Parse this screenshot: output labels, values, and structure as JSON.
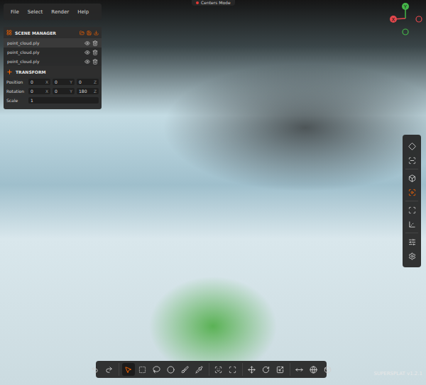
{
  "menu": {
    "items": [
      "File",
      "Select",
      "Render",
      "Help"
    ]
  },
  "mode_badge": {
    "label": "Centers Mode",
    "color": "#e53935"
  },
  "gizmo": {
    "axes": [
      {
        "label": "Y",
        "color": "#45b649"
      },
      {
        "label": "X",
        "color": "#e5484d"
      }
    ]
  },
  "scene_manager": {
    "title": "SCENE MANAGER",
    "items": [
      {
        "name": "point_cloud.ply",
        "visible": true,
        "selected": true
      },
      {
        "name": "point_cloud.ply",
        "visible": true,
        "selected": false
      },
      {
        "name": "point_cloud.ply",
        "visible": true,
        "selected": false
      }
    ]
  },
  "transform": {
    "title": "TRANSFORM",
    "rows": [
      {
        "label": "Position",
        "fields": [
          {
            "value": "0",
            "axis": "X"
          },
          {
            "value": "0",
            "axis": "Y"
          },
          {
            "value": "0",
            "axis": "Z"
          }
        ]
      },
      {
        "label": "Rotation",
        "fields": [
          {
            "value": "0",
            "axis": "X"
          },
          {
            "value": "0",
            "axis": "Y"
          },
          {
            "value": "180",
            "axis": "Z"
          }
        ]
      },
      {
        "label": "Scale",
        "fields": [
          {
            "value": "1",
            "axis": ""
          }
        ]
      }
    ]
  },
  "right_toolbar": {
    "groups": [
      {
        "tools": [
          {
            "selected": false
          },
          {
            "selected": false
          }
        ]
      },
      {
        "tools": [
          {
            "selected": false
          },
          {
            "selected": true
          }
        ]
      },
      {
        "tools": [
          {
            "selected": false
          },
          {
            "selected": false
          }
        ]
      },
      {
        "tools": [
          {
            "selected": false
          },
          {
            "selected": false
          }
        ]
      }
    ]
  },
  "bottom_toolbar": {
    "groups": [
      {
        "tools": [
          {
            "selected": false
          },
          {
            "selected": false
          }
        ]
      },
      {
        "tools": [
          {
            "selected": true
          },
          {
            "selected": false
          },
          {
            "selected": false
          },
          {
            "selected": false
          },
          {
            "selected": false
          },
          {
            "selected": false
          }
        ]
      },
      {
        "tools": [
          {
            "selected": false
          },
          {
            "selected": false
          }
        ]
      },
      {
        "tools": [
          {
            "selected": false
          },
          {
            "selected": false
          },
          {
            "selected": false
          }
        ]
      },
      {
        "tools": [
          {
            "selected": false
          },
          {
            "selected": false
          },
          {
            "selected": false
          }
        ]
      }
    ]
  },
  "version": "SUPERSPLAT v1.2.1"
}
